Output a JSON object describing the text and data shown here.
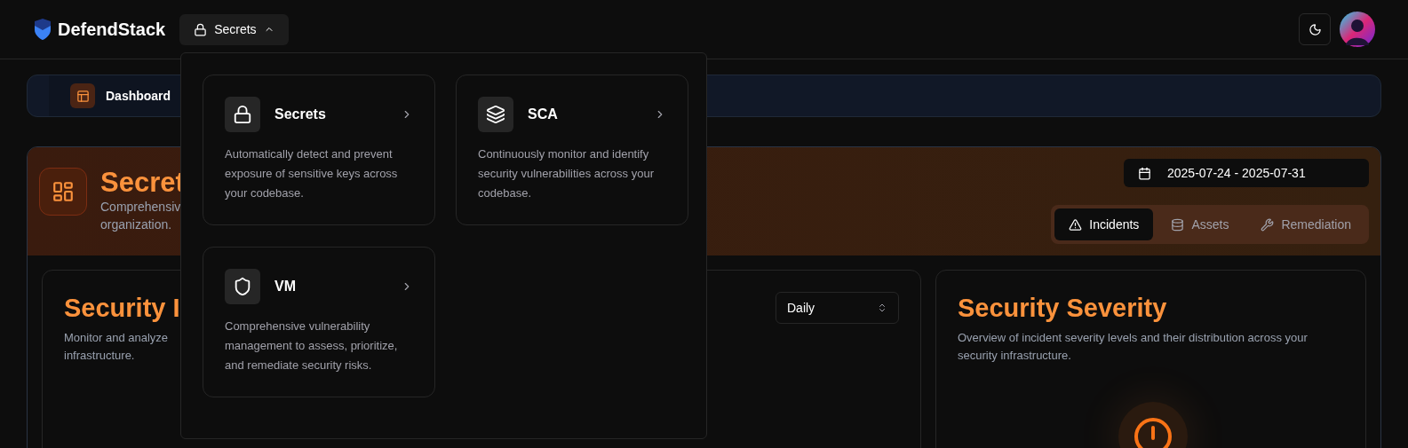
{
  "header": {
    "brand": "DefendStack",
    "product_menu": {
      "label": "Secrets",
      "expanded": true
    }
  },
  "nav": {
    "items": [
      {
        "label": "Dashboard",
        "selected": true
      }
    ]
  },
  "hero": {
    "title": "Secret",
    "subtitle_lines": [
      "Comprehensiv",
      "organization."
    ],
    "date_range": "2025-07-24 - 2025-07-31",
    "tabs": [
      {
        "label": "Incidents",
        "selected": true
      },
      {
        "label": "Assets",
        "selected": false
      },
      {
        "label": "Remediation",
        "selected": false
      }
    ]
  },
  "cards": [
    {
      "title": "Security I",
      "description_lines": [
        "Monitor and analyze",
        "infrastructure."
      ],
      "select": "Daily"
    },
    {
      "title": "Security Severity",
      "description_lines": [
        "Overview of incident severity levels and their distribution across your",
        "security infrastructure."
      ]
    }
  ],
  "menu": {
    "items": [
      {
        "title": "Secrets",
        "description": "Automatically detect and prevent exposure of sensitive keys across your codebase."
      },
      {
        "title": "SCA",
        "description": "Continuously monitor and identify security vulnerabilities across your codebase."
      },
      {
        "title": "VM",
        "description": "Comprehensive vulnerability management to assess, prioritize, and remediate security risks."
      }
    ]
  }
}
